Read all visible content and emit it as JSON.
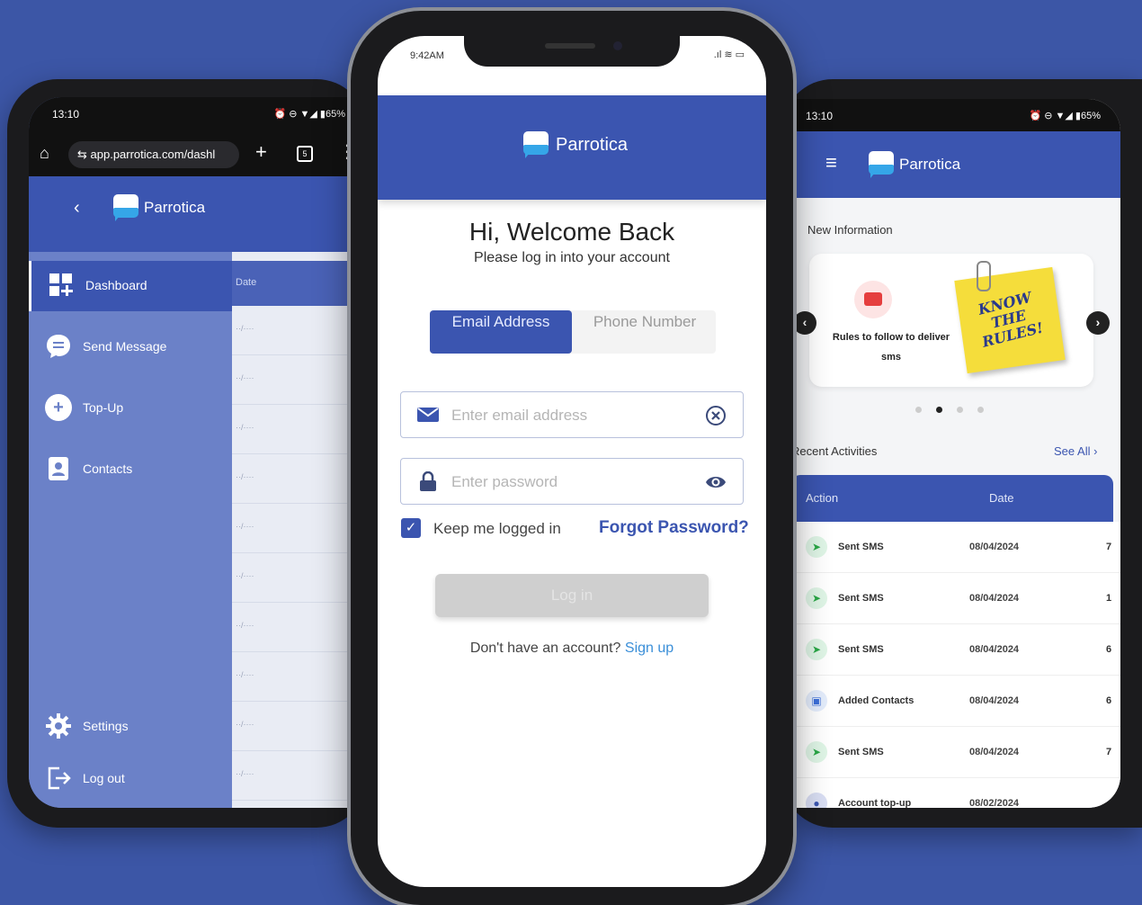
{
  "colors": {
    "background": "#3c56a6",
    "brand_blue": "#3b55b0",
    "logo_cyan": "#35a6e8",
    "link": "#3b8fd8"
  },
  "brand": {
    "name": "Parrotica"
  },
  "left_phone": {
    "status": {
      "time": "13:10",
      "battery": "65%"
    },
    "browser": {
      "url": "app.parrotica.com/dashl",
      "tab_count": "5"
    },
    "nav": {
      "dashboard": "Dashboard",
      "send_message": "Send Message",
      "topup": "Top-Up",
      "contacts": "Contacts",
      "settings": "Settings",
      "logout": "Log out"
    },
    "table": {
      "header": "Date"
    }
  },
  "center_phone": {
    "status": {
      "time": "9:42AM"
    },
    "welcome_title": "Hi, Welcome Back",
    "welcome_subtitle": "Please log in into your account",
    "tabs": {
      "email": "Email Address",
      "phone": "Phone Number"
    },
    "email_placeholder": "Enter email address",
    "password_placeholder": "Enter password",
    "keep_logged_in": "Keep me logged in",
    "forgot_password": "Forgot Password?",
    "login_button": "Log in",
    "signup_prompt": "Don't have an account?",
    "signup_link": "Sign up"
  },
  "right_phone": {
    "status": {
      "time": "13:10",
      "battery": "65%"
    },
    "new_info_title": "New Information",
    "card_caption": "Rules to follow to deliver sms",
    "note_text": "KNOW THE RULES!",
    "recent_title": "Recent Activities",
    "see_all": "See All",
    "table_headers": {
      "action": "Action",
      "date": "Date"
    },
    "activities": [
      {
        "action": "Sent SMS",
        "date": "08/04/2024",
        "amount": "7",
        "icon": "send-icon"
      },
      {
        "action": "Sent SMS",
        "date": "08/04/2024",
        "amount": "1",
        "icon": "send-icon"
      },
      {
        "action": "Sent SMS",
        "date": "08/04/2024",
        "amount": "6",
        "icon": "send-icon"
      },
      {
        "action": "Added Contacts",
        "date": "08/04/2024",
        "amount": "6",
        "icon": "contact-icon"
      },
      {
        "action": "Sent SMS",
        "date": "08/04/2024",
        "amount": "7",
        "icon": "send-icon"
      },
      {
        "action": "Account top-up",
        "date": "08/02/2024",
        "amount": "",
        "icon": "topup-icon"
      }
    ]
  }
}
